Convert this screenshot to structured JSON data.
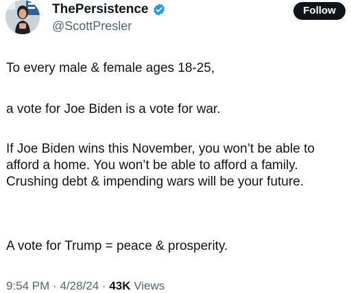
{
  "author": {
    "display_name": "ThePersistence",
    "handle": "@ScottPresler",
    "verified_icon": "verified-badge-icon",
    "verified_color": "#1d9bf0"
  },
  "header": {
    "follow_label": "Follow"
  },
  "tweet": {
    "paragraphs": [
      "To every male & female ages 18-25,",
      "a vote for Joe Biden is a vote for war.",
      "If Joe Biden wins this November, you won’t be able to afford a home. You won’t be able to afford a family. Crushing debt & impending wars will be your future.",
      "A vote for Trump = peace & prosperity."
    ]
  },
  "meta": {
    "time": "9:54 PM",
    "date": "4/28/24",
    "separator": "·",
    "views_count": "43K",
    "views_label": "Views"
  },
  "colors": {
    "text_primary": "#0f1419",
    "text_secondary": "#536471",
    "follow_button_bg": "#0f1419"
  }
}
